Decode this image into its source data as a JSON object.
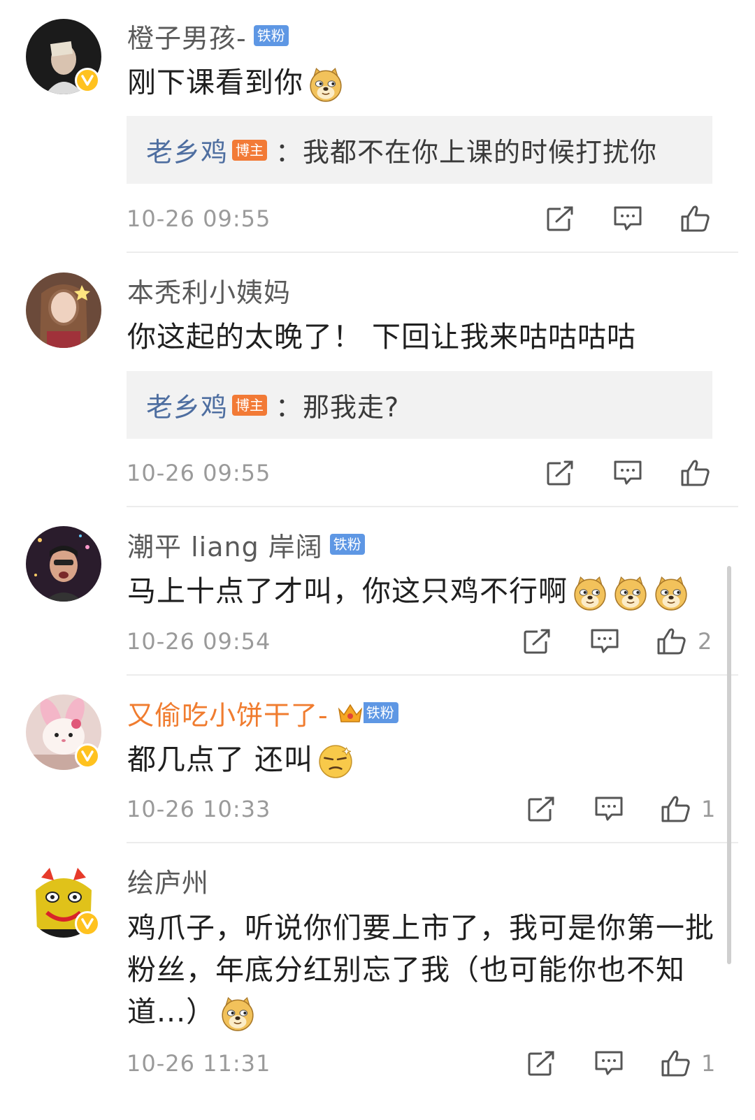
{
  "comments": [
    {
      "username": "橙子男孩-",
      "badge": "铁粉",
      "text": "刚下课看到你",
      "emoji": [
        "doge-emoji"
      ],
      "verified": true,
      "reply": {
        "name": "老乡鸡",
        "tag": "博主",
        "separator": "：",
        "text": "我都不在你上课的时候打扰你"
      },
      "time": "10-26 09:55",
      "likes": ""
    },
    {
      "username": "本秃利小姨妈",
      "badge": "",
      "text": "你这起的太晚了！ 下回让我来咕咕咕咕",
      "emoji": [],
      "verified": false,
      "reply": {
        "name": "老乡鸡",
        "tag": "博主",
        "separator": "：",
        "text": "那我走?"
      },
      "time": "10-26 09:55",
      "likes": ""
    },
    {
      "username": "潮平 liang 岸阔",
      "badge": "铁粉",
      "text": "马上十点了才叫，你这只鸡不行啊",
      "emoji": [
        "doge-emoji",
        "doge-emoji",
        "doge-emoji"
      ],
      "verified": false,
      "time": "10-26 09:54",
      "likes": "2"
    },
    {
      "username": "又偷吃小饼干了-",
      "badge": "铁粉",
      "text": "都几点了 还叫",
      "emoji": [
        "smug-emoji"
      ],
      "verified": true,
      "time": "10-26 10:33",
      "likes": "1"
    },
    {
      "username": "绘庐州",
      "badge": "",
      "text": "鸡爪子，听说你们要上市了，我可是你第一批粉丝，年底分红别忘了我（也可能你也不知道...）",
      "emoji": [
        "doge-emoji"
      ],
      "verified": true,
      "time": "10-26 11:31",
      "likes": "1"
    }
  ],
  "icons": {
    "repost": "repost-icon",
    "comment": "comment-icon",
    "like": "like-icon",
    "verified": "verified-badge-icon",
    "crown": "crown-icon"
  },
  "colors": {
    "fan_badge": "#5e97e4",
    "host_badge": "#f27a36",
    "reply_name": "#4e6ea0",
    "highlight_name": "#f07c2f",
    "verified": "#ffc21f"
  }
}
